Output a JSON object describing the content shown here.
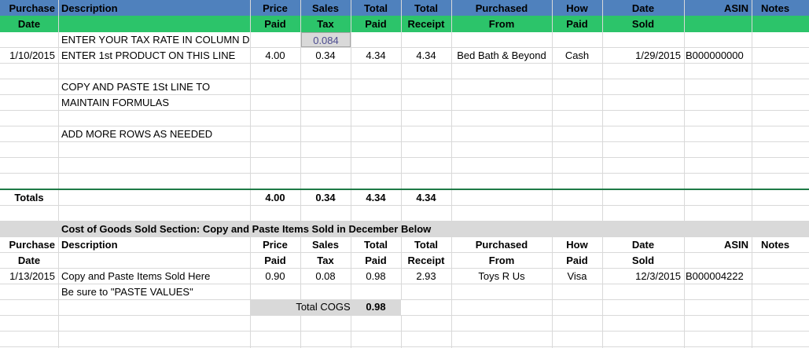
{
  "colors": {
    "header_blue": "#4f81bd",
    "header_green": "#2cc46a",
    "gray_fill": "#d9d9d9",
    "tax_rate_fill": "#d9d9d9",
    "totals_line": "#1e7a46"
  },
  "header": {
    "row1": [
      "Purchase",
      "Description",
      "Price",
      "Sales",
      "Total",
      "Total",
      "Purchased",
      "How",
      "Date",
      "ASIN",
      "Notes"
    ],
    "row2": [
      "Date",
      "",
      "Paid",
      "Tax",
      "Paid",
      "Receipt",
      "From",
      "Paid",
      "Sold",
      "",
      ""
    ]
  },
  "instructions": {
    "tax_rate_label": "ENTER YOUR TAX RATE IN COLUMN D",
    "tax_rate_value": "0.084",
    "copy_line1": "COPY AND PASTE 1St LINE TO",
    "copy_line2": "MAINTAIN FORMULAS",
    "add_rows": "ADD MORE ROWS AS NEEDED"
  },
  "first_row": {
    "date": "1/10/2015",
    "description": "ENTER 1st PRODUCT ON THIS LINE",
    "price": "4.00",
    "tax": "0.34",
    "total_paid": "4.34",
    "total_receipt": "4.34",
    "from": "Bed Bath & Beyond",
    "how_paid": "Cash",
    "date_sold": "1/29/2015",
    "asin": "B000000000"
  },
  "totals": {
    "label": "Totals",
    "price": "4.00",
    "tax": "0.34",
    "total_paid": "4.34",
    "total_receipt": "4.34"
  },
  "cogs": {
    "section_title": "Cost of Goods Sold Section: Copy and Paste Items Sold in December Below",
    "header_row1": [
      "Purchase",
      "Description",
      "Price",
      "Sales",
      "Total",
      "Total",
      "Purchased",
      "How",
      "Date",
      "ASIN",
      "Notes"
    ],
    "header_row2": [
      "Date",
      "",
      "Paid",
      "Tax",
      "Paid",
      "Receipt",
      "From",
      "Paid",
      "Sold",
      "",
      ""
    ],
    "item": {
      "date": "1/13/2015",
      "description": "Copy and Paste Items Sold Here",
      "price": "0.90",
      "tax": "0.08",
      "total_paid": "0.98",
      "total_receipt": "2.93",
      "from": "Toys R Us",
      "how_paid": "Visa",
      "date_sold": "12/3/2015",
      "asin": "B000004222"
    },
    "paste_note": "Be sure to \"PASTE VALUES\"",
    "total_label": "Total COGS",
    "total_value": "0.98"
  }
}
